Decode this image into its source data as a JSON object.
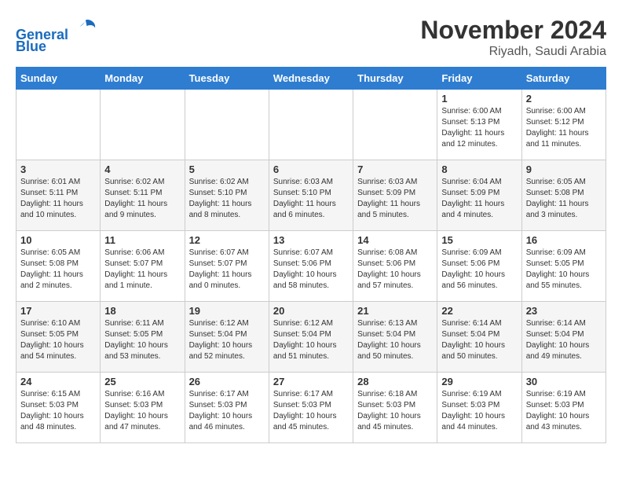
{
  "header": {
    "logo_line1": "General",
    "logo_line2": "Blue",
    "month": "November 2024",
    "location": "Riyadh, Saudi Arabia"
  },
  "weekdays": [
    "Sunday",
    "Monday",
    "Tuesday",
    "Wednesday",
    "Thursday",
    "Friday",
    "Saturday"
  ],
  "weeks": [
    [
      {
        "day": "",
        "info": ""
      },
      {
        "day": "",
        "info": ""
      },
      {
        "day": "",
        "info": ""
      },
      {
        "day": "",
        "info": ""
      },
      {
        "day": "",
        "info": ""
      },
      {
        "day": "1",
        "info": "Sunrise: 6:00 AM\nSunset: 5:13 PM\nDaylight: 11 hours\nand 12 minutes."
      },
      {
        "day": "2",
        "info": "Sunrise: 6:00 AM\nSunset: 5:12 PM\nDaylight: 11 hours\nand 11 minutes."
      }
    ],
    [
      {
        "day": "3",
        "info": "Sunrise: 6:01 AM\nSunset: 5:11 PM\nDaylight: 11 hours\nand 10 minutes."
      },
      {
        "day": "4",
        "info": "Sunrise: 6:02 AM\nSunset: 5:11 PM\nDaylight: 11 hours\nand 9 minutes."
      },
      {
        "day": "5",
        "info": "Sunrise: 6:02 AM\nSunset: 5:10 PM\nDaylight: 11 hours\nand 8 minutes."
      },
      {
        "day": "6",
        "info": "Sunrise: 6:03 AM\nSunset: 5:10 PM\nDaylight: 11 hours\nand 6 minutes."
      },
      {
        "day": "7",
        "info": "Sunrise: 6:03 AM\nSunset: 5:09 PM\nDaylight: 11 hours\nand 5 minutes."
      },
      {
        "day": "8",
        "info": "Sunrise: 6:04 AM\nSunset: 5:09 PM\nDaylight: 11 hours\nand 4 minutes."
      },
      {
        "day": "9",
        "info": "Sunrise: 6:05 AM\nSunset: 5:08 PM\nDaylight: 11 hours\nand 3 minutes."
      }
    ],
    [
      {
        "day": "10",
        "info": "Sunrise: 6:05 AM\nSunset: 5:08 PM\nDaylight: 11 hours\nand 2 minutes."
      },
      {
        "day": "11",
        "info": "Sunrise: 6:06 AM\nSunset: 5:07 PM\nDaylight: 11 hours\nand 1 minute."
      },
      {
        "day": "12",
        "info": "Sunrise: 6:07 AM\nSunset: 5:07 PM\nDaylight: 11 hours\nand 0 minutes."
      },
      {
        "day": "13",
        "info": "Sunrise: 6:07 AM\nSunset: 5:06 PM\nDaylight: 10 hours\nand 58 minutes."
      },
      {
        "day": "14",
        "info": "Sunrise: 6:08 AM\nSunset: 5:06 PM\nDaylight: 10 hours\nand 57 minutes."
      },
      {
        "day": "15",
        "info": "Sunrise: 6:09 AM\nSunset: 5:06 PM\nDaylight: 10 hours\nand 56 minutes."
      },
      {
        "day": "16",
        "info": "Sunrise: 6:09 AM\nSunset: 5:05 PM\nDaylight: 10 hours\nand 55 minutes."
      }
    ],
    [
      {
        "day": "17",
        "info": "Sunrise: 6:10 AM\nSunset: 5:05 PM\nDaylight: 10 hours\nand 54 minutes."
      },
      {
        "day": "18",
        "info": "Sunrise: 6:11 AM\nSunset: 5:05 PM\nDaylight: 10 hours\nand 53 minutes."
      },
      {
        "day": "19",
        "info": "Sunrise: 6:12 AM\nSunset: 5:04 PM\nDaylight: 10 hours\nand 52 minutes."
      },
      {
        "day": "20",
        "info": "Sunrise: 6:12 AM\nSunset: 5:04 PM\nDaylight: 10 hours\nand 51 minutes."
      },
      {
        "day": "21",
        "info": "Sunrise: 6:13 AM\nSunset: 5:04 PM\nDaylight: 10 hours\nand 50 minutes."
      },
      {
        "day": "22",
        "info": "Sunrise: 6:14 AM\nSunset: 5:04 PM\nDaylight: 10 hours\nand 50 minutes."
      },
      {
        "day": "23",
        "info": "Sunrise: 6:14 AM\nSunset: 5:04 PM\nDaylight: 10 hours\nand 49 minutes."
      }
    ],
    [
      {
        "day": "24",
        "info": "Sunrise: 6:15 AM\nSunset: 5:03 PM\nDaylight: 10 hours\nand 48 minutes."
      },
      {
        "day": "25",
        "info": "Sunrise: 6:16 AM\nSunset: 5:03 PM\nDaylight: 10 hours\nand 47 minutes."
      },
      {
        "day": "26",
        "info": "Sunrise: 6:17 AM\nSunset: 5:03 PM\nDaylight: 10 hours\nand 46 minutes."
      },
      {
        "day": "27",
        "info": "Sunrise: 6:17 AM\nSunset: 5:03 PM\nDaylight: 10 hours\nand 45 minutes."
      },
      {
        "day": "28",
        "info": "Sunrise: 6:18 AM\nSunset: 5:03 PM\nDaylight: 10 hours\nand 45 minutes."
      },
      {
        "day": "29",
        "info": "Sunrise: 6:19 AM\nSunset: 5:03 PM\nDaylight: 10 hours\nand 44 minutes."
      },
      {
        "day": "30",
        "info": "Sunrise: 6:19 AM\nSunset: 5:03 PM\nDaylight: 10 hours\nand 43 minutes."
      }
    ]
  ]
}
